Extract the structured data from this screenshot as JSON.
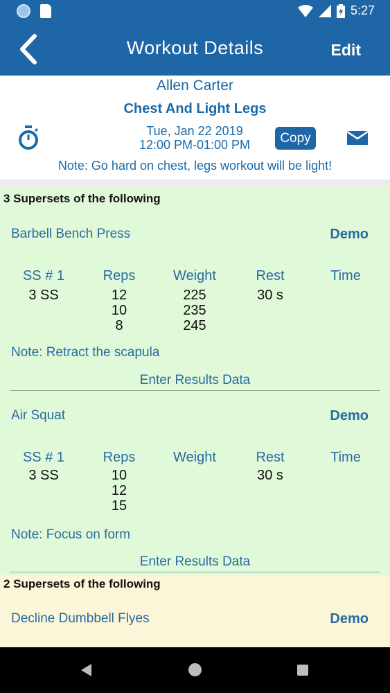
{
  "status_bar": {
    "time": "5:27"
  },
  "app_bar": {
    "title": "Workout Details",
    "edit_label": "Edit"
  },
  "workout": {
    "client": "Allen Carter",
    "name": "Chest And Light Legs",
    "date": "Tue, Jan 22 2019",
    "time_range": "12:00 PM-01:00 PM",
    "copy_label": "Copy",
    "note": "Note: Go hard on chest, legs workout will be light!"
  },
  "groups": [
    {
      "title": "3 Supersets of the following",
      "exercises": [
        {
          "name": "Barbell Bench Press",
          "demo_label": "Demo",
          "headers": [
            "SS # 1",
            "Reps",
            "Weight",
            "Rest",
            "Time"
          ],
          "sets": "3 SS",
          "reps": [
            "12",
            "10",
            "8"
          ],
          "weights": [
            "225",
            "235",
            "245"
          ],
          "rest": "30 s",
          "note": "Note: Retract the scapula",
          "enter_label": "Enter Results Data"
        },
        {
          "name": "Air Squat",
          "demo_label": "Demo",
          "headers": [
            "SS # 1",
            "Reps",
            "Weight",
            "Rest",
            "Time"
          ],
          "sets": "3 SS",
          "reps": [
            "10",
            "12",
            "15"
          ],
          "rest": "30 s",
          "note": "Note: Focus on form",
          "enter_label": "Enter Results Data"
        }
      ]
    },
    {
      "title": "2 Supersets of the following",
      "exercises": [
        {
          "name": "Decline Dumbbell Flyes",
          "demo_label": "Demo"
        }
      ]
    }
  ],
  "colors": {
    "primary": "#1f66a6",
    "section_green": "#e0f9d9",
    "section_yellow": "#fbf6d7",
    "link_text": "#2a6aa0"
  }
}
